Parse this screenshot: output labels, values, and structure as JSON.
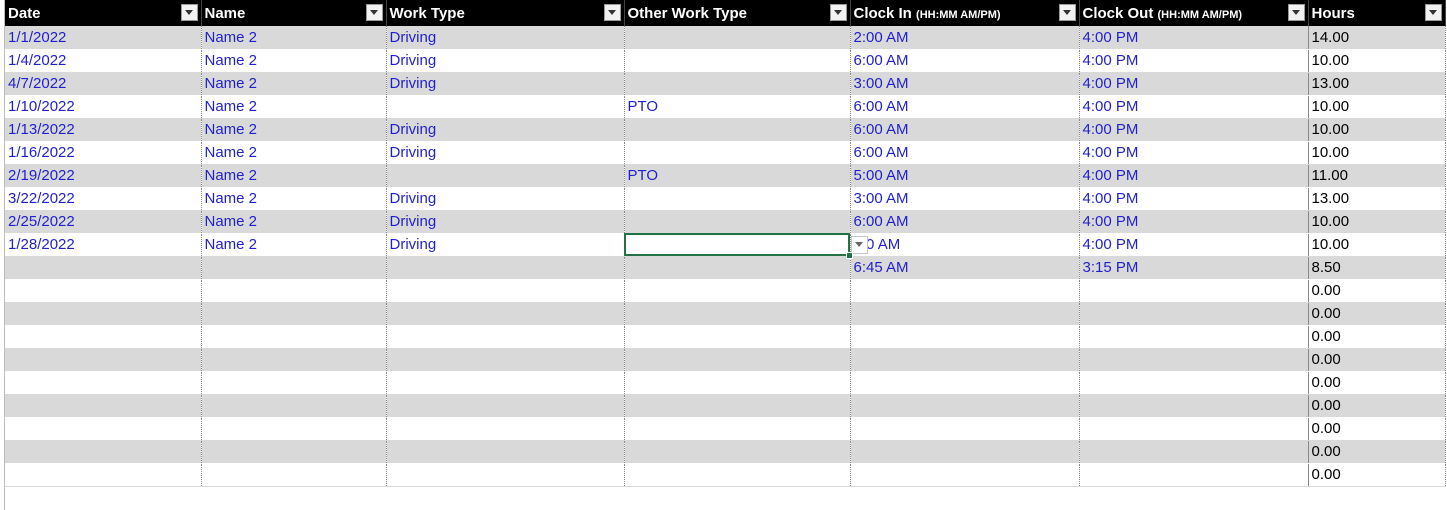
{
  "columns": [
    {
      "key": "date",
      "label": "Date",
      "sub": ""
    },
    {
      "key": "name",
      "label": "Name",
      "sub": ""
    },
    {
      "key": "work_type",
      "label": "Work Type",
      "sub": ""
    },
    {
      "key": "other_work_type",
      "label": "Other Work Type",
      "sub": ""
    },
    {
      "key": "clock_in",
      "label": "Clock In",
      "sub": "(HH:MM AM/PM)"
    },
    {
      "key": "clock_out",
      "label": "Clock Out",
      "sub": "(HH:MM AM/PM)"
    },
    {
      "key": "hours",
      "label": "Hours",
      "sub": ""
    }
  ],
  "rows": [
    {
      "date": "1/1/2022",
      "name": "Name 2",
      "work_type": "Driving",
      "other_work_type": "",
      "clock_in": "2:00 AM",
      "clock_out": "4:00 PM",
      "hours": "14.00"
    },
    {
      "date": "1/4/2022",
      "name": "Name 2",
      "work_type": "Driving",
      "other_work_type": "",
      "clock_in": "6:00 AM",
      "clock_out": "4:00 PM",
      "hours": "10.00"
    },
    {
      "date": "4/7/2022",
      "name": "Name 2",
      "work_type": "Driving",
      "other_work_type": "",
      "clock_in": "3:00 AM",
      "clock_out": "4:00 PM",
      "hours": "13.00"
    },
    {
      "date": "1/10/2022",
      "name": "Name 2",
      "work_type": "",
      "other_work_type": "PTO",
      "clock_in": "6:00 AM",
      "clock_out": "4:00 PM",
      "hours": "10.00"
    },
    {
      "date": "1/13/2022",
      "name": "Name 2",
      "work_type": "Driving",
      "other_work_type": "",
      "clock_in": "6:00 AM",
      "clock_out": "4:00 PM",
      "hours": "10.00"
    },
    {
      "date": "1/16/2022",
      "name": "Name 2",
      "work_type": "Driving",
      "other_work_type": "",
      "clock_in": "6:00 AM",
      "clock_out": "4:00 PM",
      "hours": "10.00"
    },
    {
      "date": "2/19/2022",
      "name": "Name 2",
      "work_type": "",
      "other_work_type": "PTO",
      "clock_in": "5:00 AM",
      "clock_out": "4:00 PM",
      "hours": "11.00"
    },
    {
      "date": "3/22/2022",
      "name": "Name 2",
      "work_type": "Driving",
      "other_work_type": "",
      "clock_in": "3:00 AM",
      "clock_out": "4:00 PM",
      "hours": "13.00"
    },
    {
      "date": "2/25/2022",
      "name": "Name 2",
      "work_type": "Driving",
      "other_work_type": "",
      "clock_in": "6:00 AM",
      "clock_out": "4:00 PM",
      "hours": "10.00"
    },
    {
      "date": "1/28/2022",
      "name": "Name 2",
      "work_type": "Driving",
      "other_work_type": "",
      "clock_in": ":00 AM",
      "clock_out": "4:00 PM",
      "hours": "10.00"
    },
    {
      "date": "",
      "name": "",
      "work_type": "",
      "other_work_type": "",
      "clock_in": "6:45 AM",
      "clock_out": "3:15 PM",
      "hours": "8.50"
    },
    {
      "date": "",
      "name": "",
      "work_type": "",
      "other_work_type": "",
      "clock_in": "",
      "clock_out": "",
      "hours": "0.00"
    },
    {
      "date": "",
      "name": "",
      "work_type": "",
      "other_work_type": "",
      "clock_in": "",
      "clock_out": "",
      "hours": "0.00"
    },
    {
      "date": "",
      "name": "",
      "work_type": "",
      "other_work_type": "",
      "clock_in": "",
      "clock_out": "",
      "hours": "0.00"
    },
    {
      "date": "",
      "name": "",
      "work_type": "",
      "other_work_type": "",
      "clock_in": "",
      "clock_out": "",
      "hours": "0.00"
    },
    {
      "date": "",
      "name": "",
      "work_type": "",
      "other_work_type": "",
      "clock_in": "",
      "clock_out": "",
      "hours": "0.00"
    },
    {
      "date": "",
      "name": "",
      "work_type": "",
      "other_work_type": "",
      "clock_in": "",
      "clock_out": "",
      "hours": "0.00"
    },
    {
      "date": "",
      "name": "",
      "work_type": "",
      "other_work_type": "",
      "clock_in": "",
      "clock_out": "",
      "hours": "0.00"
    },
    {
      "date": "",
      "name": "",
      "work_type": "",
      "other_work_type": "",
      "clock_in": "",
      "clock_out": "",
      "hours": "0.00"
    },
    {
      "date": "",
      "name": "",
      "work_type": "",
      "other_work_type": "",
      "clock_in": "",
      "clock_out": "",
      "hours": "0.00"
    }
  ],
  "selected_cell": {
    "row": 9,
    "column": "other_work_type"
  },
  "colors": {
    "header_bg": "#000000",
    "header_text": "#ffffff",
    "band": "#d9d9d9",
    "entry_text": "#1f1fcf",
    "selection": "#217346"
  },
  "icons": {
    "filter": "chevron-down-icon",
    "dropdown": "chevron-down-icon"
  }
}
